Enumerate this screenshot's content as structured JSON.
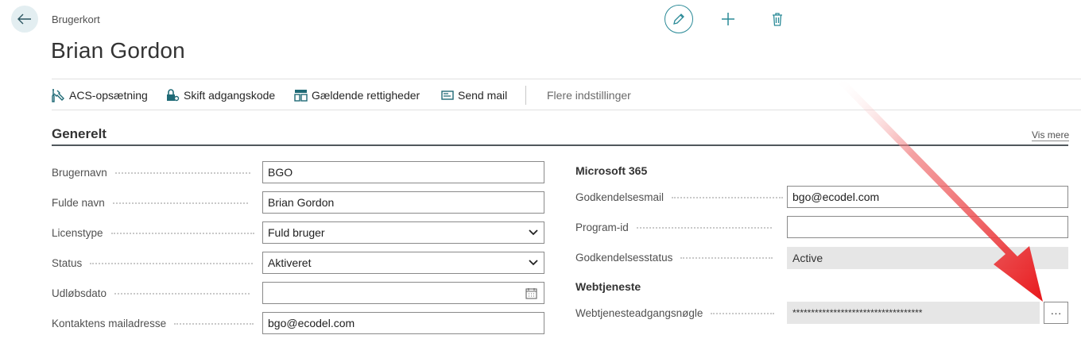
{
  "header": {
    "caption": "Brugerkort",
    "title": "Brian Gordon"
  },
  "icons": {
    "back": "arrow-left-icon",
    "edit": "pencil-icon",
    "new": "plus-icon",
    "delete": "trash-icon"
  },
  "actions": [
    {
      "label": "ACS-opsætning",
      "icon": "tools-icon"
    },
    {
      "label": "Skift adgangskode",
      "icon": "lock-key-icon"
    },
    {
      "label": "Gældende rettigheder",
      "icon": "permissions-icon"
    },
    {
      "label": "Send mail",
      "icon": "mail-icon"
    },
    {
      "label": "Flere indstillinger"
    }
  ],
  "section": {
    "title": "Generelt",
    "show_more": "Vis mere"
  },
  "left_fields": [
    {
      "label": "Brugernavn",
      "value": "BGO"
    },
    {
      "label": "Fulde navn",
      "value": "Brian Gordon"
    },
    {
      "label": "Licenstype",
      "value": "Fuld bruger"
    },
    {
      "label": "Status",
      "value": "Aktiveret"
    },
    {
      "label": "Udløbsdato",
      "value": ""
    },
    {
      "label": "Kontaktens mailadresse",
      "value": "bgo@ecodel.com"
    }
  ],
  "right": {
    "group1_title": "Microsoft 365",
    "fields": [
      {
        "label": "Godkendelsesmail",
        "value": "bgo@ecodel.com"
      },
      {
        "label": "Program-id",
        "value": ""
      },
      {
        "label": "Godkendelsesstatus",
        "value": "Active"
      }
    ],
    "group2_title": "Webtjeneste",
    "webservice": {
      "label": "Webtjenesteadgangsnøgle",
      "value": "***********************************",
      "button": "···"
    }
  },
  "colors": {
    "accent": "#2a8a97",
    "arrow": "#e8181b"
  }
}
